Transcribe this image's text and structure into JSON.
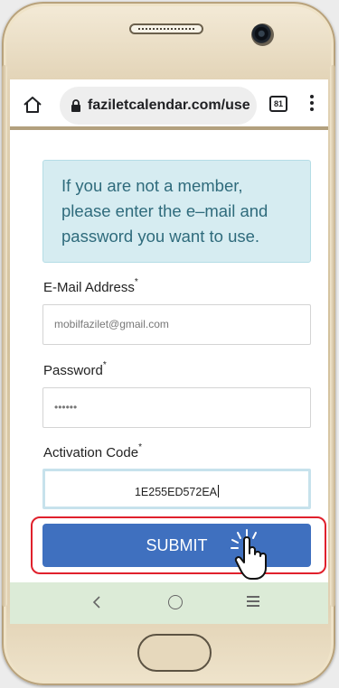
{
  "browser": {
    "url": "faziletcalendar.com/use",
    "tab_count": "81"
  },
  "form": {
    "notice": "If you are not a member, please enter the e–mail and password you want to use.",
    "email_label": "E-Mail Address",
    "email_value": "mobilfazilet@gmail.com",
    "password_label": "Password",
    "password_value": "••••••",
    "activation_label": "Activation Code",
    "activation_value": "1E255ED572EA",
    "required_mark": "*",
    "submit_label": "SUBMIT"
  },
  "colors": {
    "submit": "#3f70bf",
    "highlight": "#e0202c",
    "notice_bg": "#d6ecf1",
    "nav_bg": "#dcebd7"
  },
  "icons": [
    "home-icon",
    "lock-icon",
    "tabs-icon",
    "more-vert-icon",
    "tap-hand-icon",
    "back-nav-icon",
    "home-nav-icon",
    "recent-apps-icon"
  ]
}
